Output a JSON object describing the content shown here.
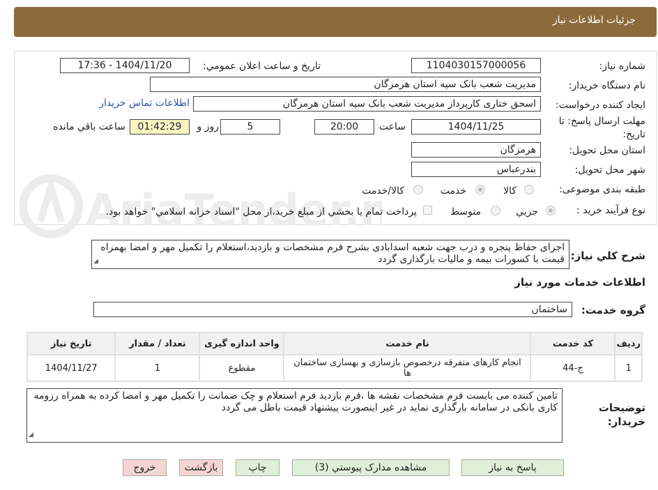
{
  "header": {
    "title": "جزئيات اطلاعات نياز"
  },
  "form": {
    "need_number_label": "شماره نياز:",
    "need_number": "1104030157000056",
    "announce_label": "تاريخ و ساعت اعلان عمومي:",
    "announce_value": "1404/11/20 - 17:36",
    "buyer_org_label": "نام دستگاه خريدار:",
    "buyer_org": "مديريت شعب بانک سپه استان هرمزگان",
    "requester_label": "ايجاد کننده درخواست:",
    "requester": "اسحق ختاری کارپرداز مديريت شعب بانک سپه استان هرمزگان",
    "contact_link": "اطلاعات تماس خريدار",
    "deadline_label": "مهلت ارسال پاسخ: تا تاریخ:",
    "deadline_date": "1404/11/25",
    "time_label": "ساعت",
    "deadline_time": "20:00",
    "days_value": "5",
    "days_label": "روز و",
    "remaining_time": "01:42:29",
    "remaining_label": "ساعت باقي مانده",
    "province_label": "استان محل تحويل:",
    "province": "هرمزگان",
    "city_label": "شهر محل تحويل:",
    "city": "بندرعباس",
    "category_label": "طبقه بندی موضوعی:",
    "category_options": [
      "کالا",
      "خدمت",
      "کالا/خدمت"
    ],
    "process_label": "نوع فرآيند خريد :",
    "process_options": [
      "جزيي",
      "متوسط"
    ],
    "payment_note": "پرداخت تمام يا بخشي از مبلغ خريد،از محل \"اسناد خزانه اسلامي\" خواهد بود."
  },
  "description": {
    "label": "شرح كلي نياز:",
    "text": "اجرای حفاظ پنجره و درب  جهت شعبه اسدابادی بشرح فرم مشخصات و بازدید،استعلام  را  تکمیل مهر و امضا بهمراه قیمت با کسورات بیمه و مالیات بارگذاری گردد"
  },
  "services": {
    "title": "اطلاعات خدمات مورد نياز",
    "group_label": "گروه خدمت:",
    "group_value": "ساختمان",
    "columns": [
      "رديف",
      "کد خدمت",
      "نام خدمت",
      "واحد اندازه گيری",
      "تعداد / مقدار",
      "تاريخ نياز"
    ],
    "rows": [
      {
        "row": "1",
        "code": "ج-44",
        "name": "انجام کارهای متفرقه درخصوص بازسازی و بهسازی ساختمان ها",
        "unit": "مقطوع",
        "qty": "1",
        "date": "1404/11/27"
      }
    ]
  },
  "buyer_notes": {
    "label": "توضيحات خريدار:",
    "text": "تامین کننده می بایست  فرم مشخصات نقشه ها  ،فرم بازدید فرم استعلام و چک ضمانت  را تکمیل مهر و امضا کرده به همراه  رزومه کاری بانکی در سامانه بارگذاری نماید در غیر اینصورت پیشنهاد قیمت  باطل می گردد"
  },
  "buttons": {
    "reply": "پاسخ به نياز",
    "attachments": "مشاهده مدارک پيوستي (3)",
    "print": "چاپ",
    "back": "بازگشت",
    "exit": "خروج"
  },
  "watermark": {
    "text": "AriaTender.neT"
  }
}
